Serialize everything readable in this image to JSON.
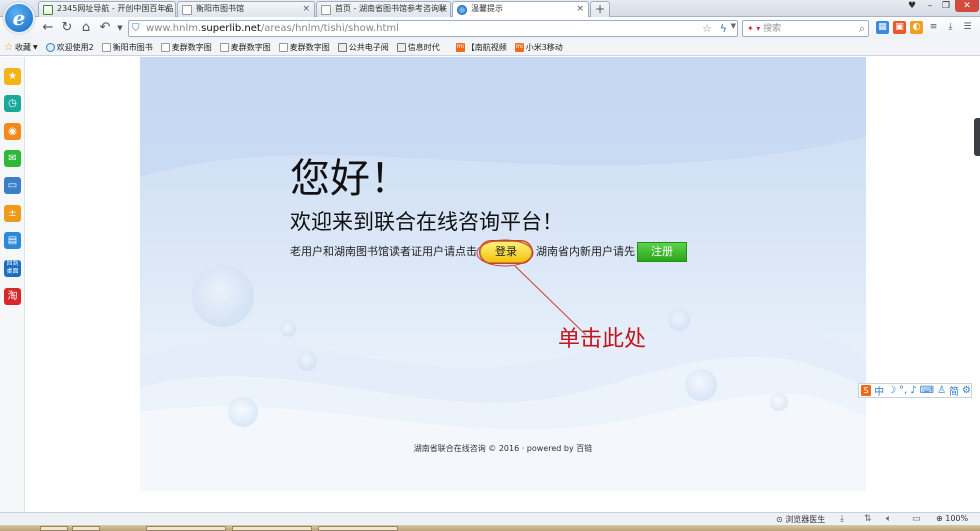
{
  "browser": {
    "tabs": [
      {
        "label": "2345网址导航 - 开创中国百年品",
        "icon": "green-house-icon"
      },
      {
        "label": "衡阳市图书馆",
        "icon": "page-icon"
      },
      {
        "label": "首页 - 湖南省图书馆参考咨询联",
        "icon": "page-icon"
      },
      {
        "label": "温馨提示",
        "icon": "ie-icon",
        "active": true
      }
    ],
    "address": {
      "prefix": "www.hnlm.",
      "domain": "superlib.net",
      "path": "/areas/hnlm/tishi/show.html"
    },
    "search_placeholder": "搜索",
    "bookmarks": [
      {
        "label": "收藏",
        "icon": "star-icon"
      },
      {
        "label": "欢迎使用2",
        "icon": "ie-icon"
      },
      {
        "label": "衡阳市图书",
        "icon": "page-icon"
      },
      {
        "label": "麦群数字图",
        "icon": "page-icon"
      },
      {
        "label": "麦群数字图",
        "icon": "page-icon"
      },
      {
        "label": "麦群数字图",
        "icon": "page-icon"
      },
      {
        "label": "公共电子阅",
        "icon": "image-icon"
      },
      {
        "label": "信息时代",
        "icon": "image-icon"
      },
      {
        "label": "【南航视频",
        "icon": "mi-icon"
      },
      {
        "label": "小米3移动",
        "icon": "mi-icon"
      }
    ],
    "status": {
      "doctor": "浏览器医生",
      "zoom": "100%"
    }
  },
  "page": {
    "hello": "您好！",
    "welcome": "欢迎来到联合在线咨询平台！",
    "login_prompt": "老用户和湖南图书馆读者证用户请点击",
    "login_button": "登录",
    "register_prompt": "湖南省内新用户请先",
    "register_button": "注册",
    "footer": "湖南省联合在线咨询 © 2016 · powered by 百链"
  },
  "annotation": {
    "text": "单击此处",
    "color": "#c0161c"
  },
  "ime": {
    "items": [
      "中",
      "简"
    ]
  },
  "colors": {
    "login_button": "#f2c20f",
    "register_button": "#2aa51a",
    "panel_bg": "#c9daf3"
  }
}
